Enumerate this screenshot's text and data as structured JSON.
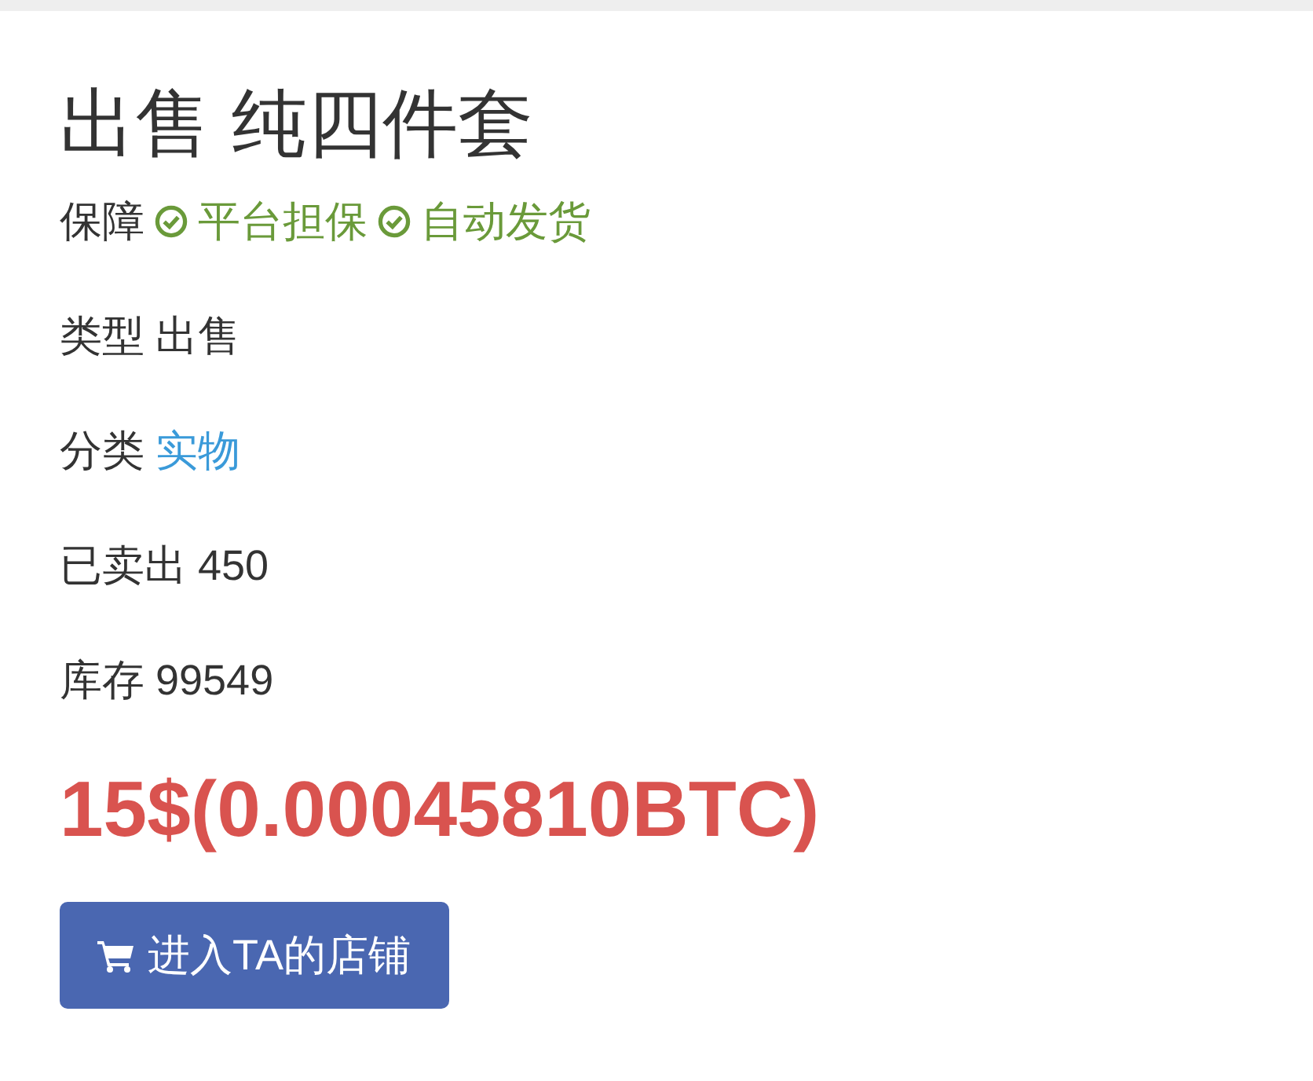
{
  "title": "出售 纯四件套",
  "guarantee": {
    "label": "保障",
    "items": [
      "平台担保",
      "自动发货"
    ]
  },
  "fields": [
    {
      "label": "类型",
      "value": "出售",
      "kind": "text"
    },
    {
      "label": "分类",
      "value": "实物",
      "kind": "link"
    },
    {
      "label": "已卖出",
      "value": "450",
      "kind": "text"
    },
    {
      "label": "库存",
      "value": "99549",
      "kind": "text"
    }
  ],
  "price": "15$(0.00045810BTC)",
  "shop_button": "进入TA的店铺"
}
